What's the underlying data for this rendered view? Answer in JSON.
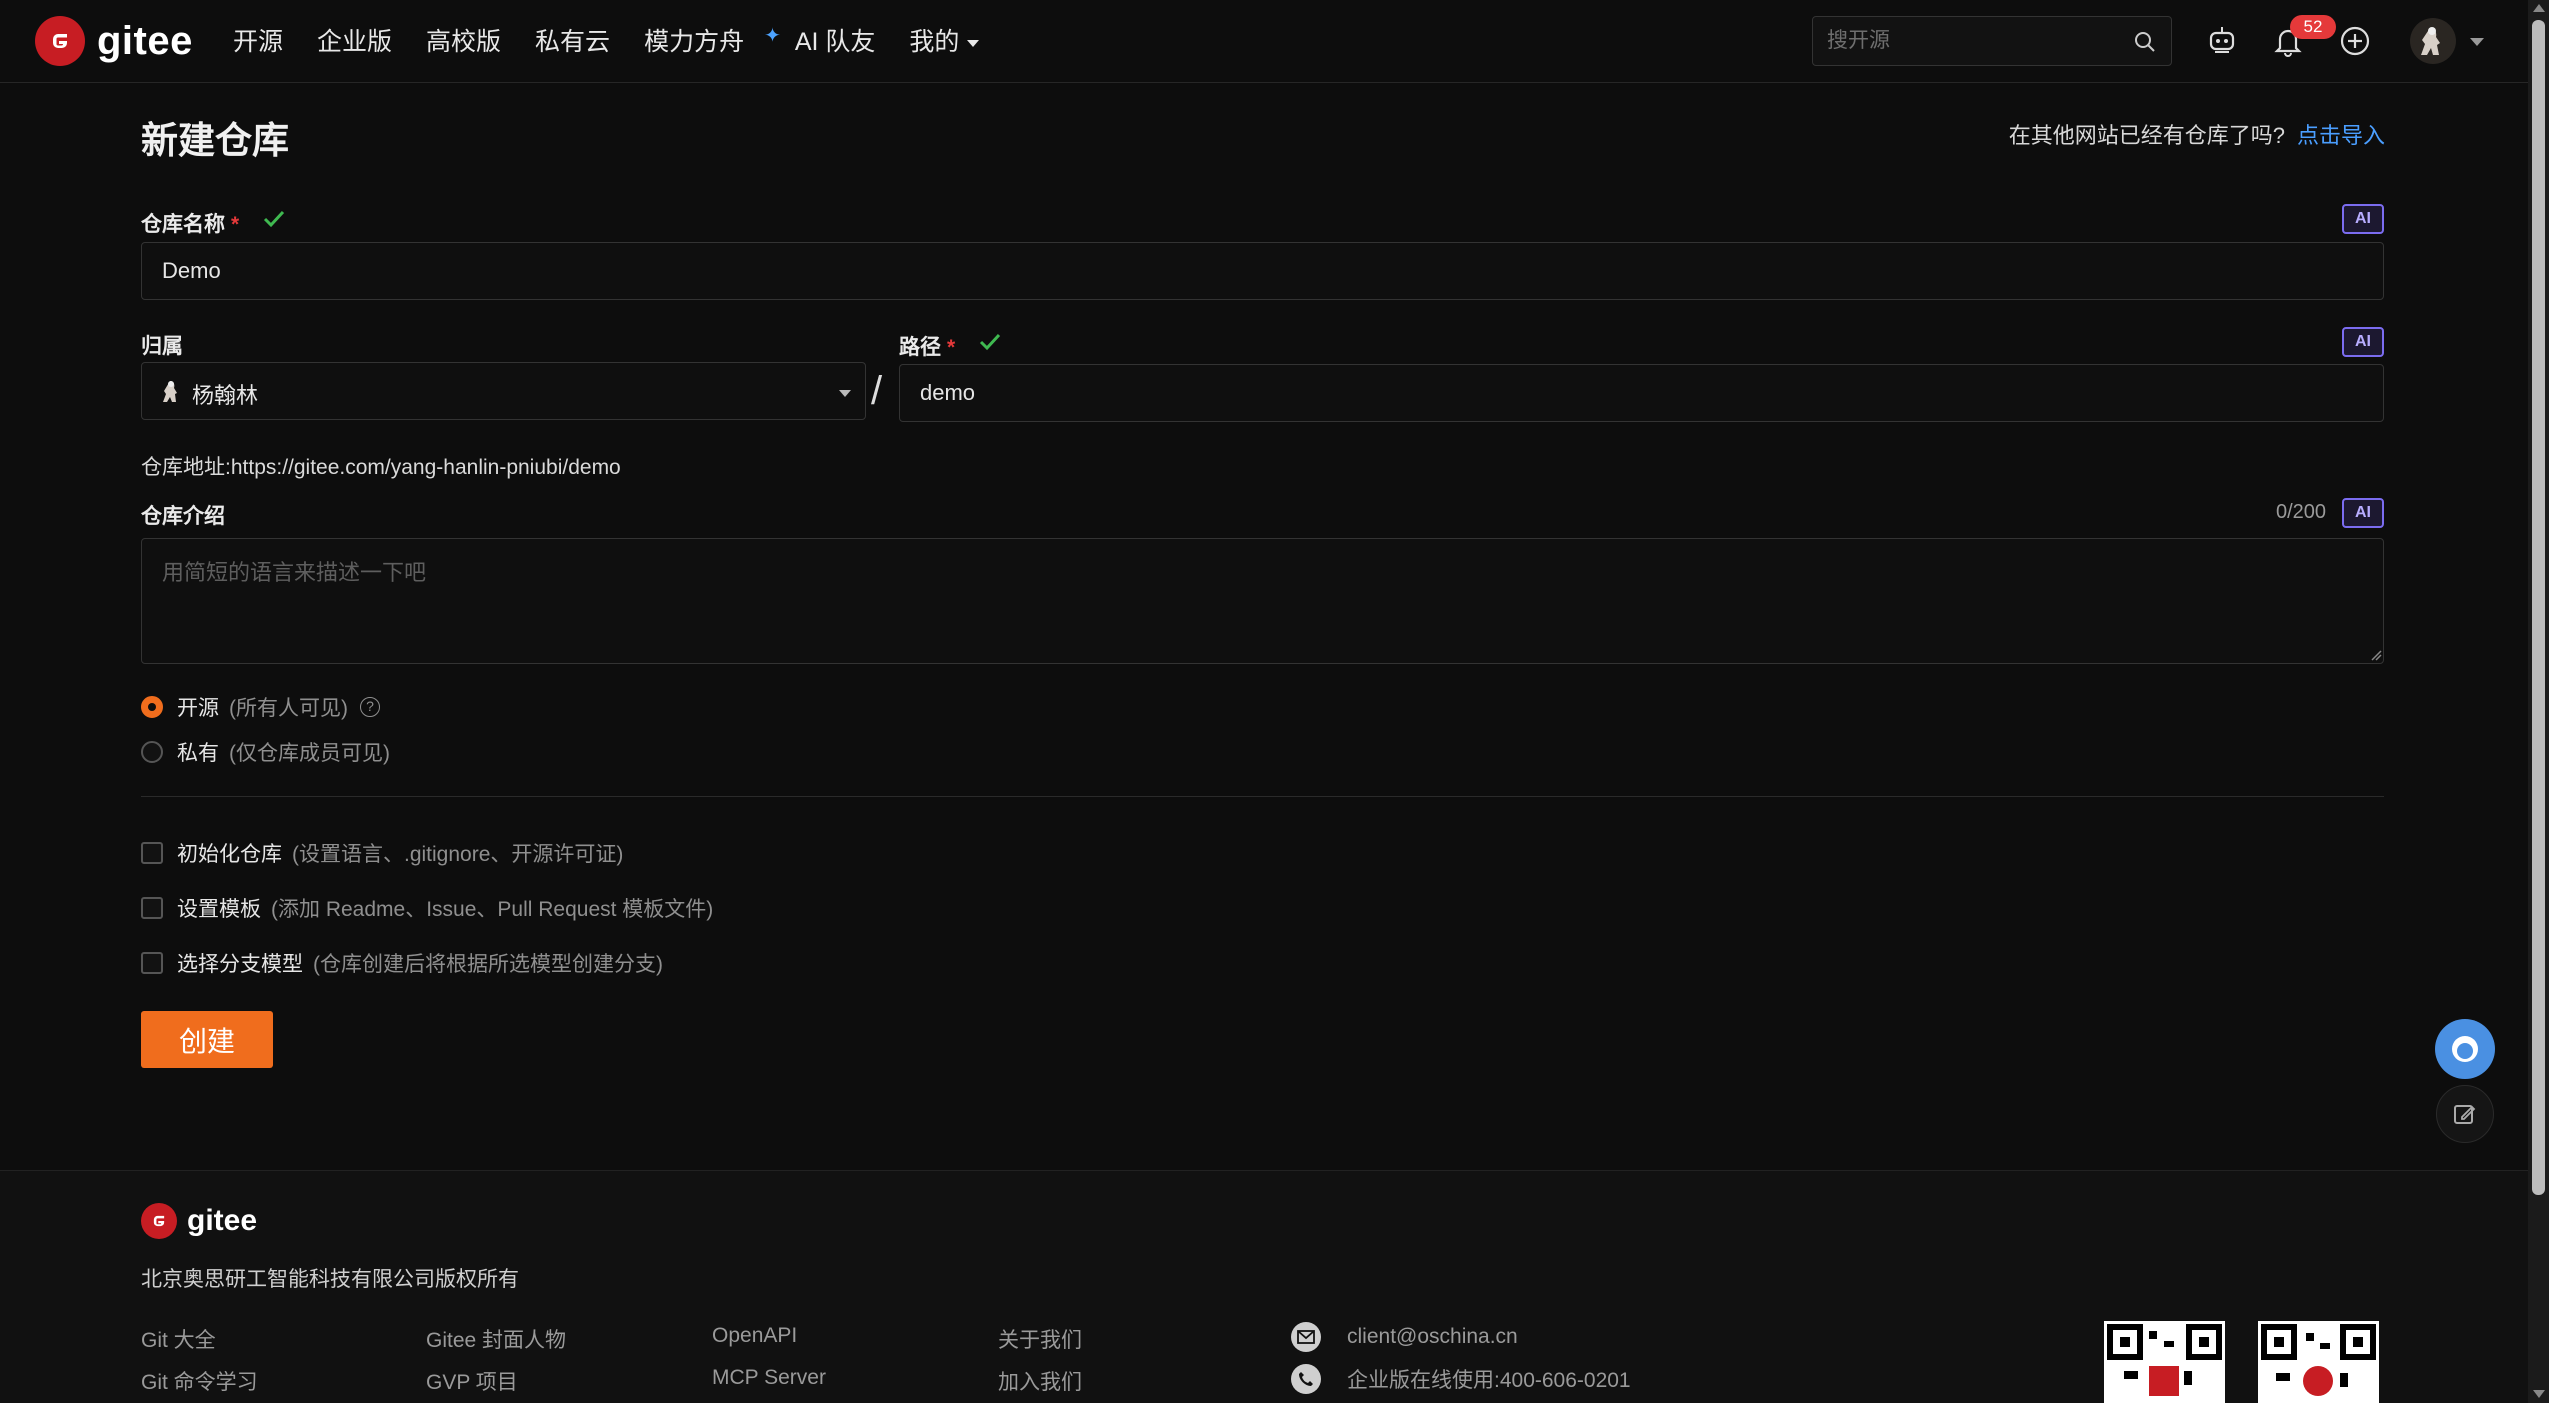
{
  "header": {
    "logo_text": "gitee",
    "nav": [
      "开源",
      "企业版",
      "高校版",
      "私有云",
      "模力方舟",
      "AI 队友",
      "我的"
    ],
    "search_placeholder": "搜开源",
    "notification_count": "52"
  },
  "page": {
    "title": "新建仓库",
    "import_prompt": "在其他网站已经有仓库了吗?",
    "import_link": "点击导入"
  },
  "form": {
    "name_label": "仓库名称",
    "required_mark": "*",
    "name_value": "Demo",
    "ai_label": "AI",
    "owner_label": "归属",
    "owner_value": "杨翰林",
    "path_label": "路径",
    "path_value": "demo",
    "slash": "/",
    "address_label": "仓库地址:",
    "address_value": "https://gitee.com/yang-hanlin-pniubi/demo",
    "desc_label": "仓库介绍",
    "desc_counter": "0/200",
    "desc_placeholder": "用简短的语言来描述一下吧",
    "visibility": [
      {
        "label": "开源",
        "hint": "(所有人可见)",
        "selected": true
      },
      {
        "label": "私有",
        "hint": "(仅仓库成员可见)",
        "selected": false
      }
    ],
    "options": [
      {
        "label": "初始化仓库",
        "hint": "(设置语言、.gitignore、开源许可证)",
        "checked": false
      },
      {
        "label": "设置模板",
        "hint": "(添加 Readme、Issue、Pull Request 模板文件)",
        "checked": false
      },
      {
        "label": "选择分支模型",
        "hint": "(仓库创建后将根据所选模型创建分支)",
        "checked": false
      }
    ],
    "submit_label": "创建"
  },
  "footer": {
    "logo_text": "gitee",
    "copyright": "北京奥思研工智能科技有限公司版权所有",
    "links": [
      [
        "Git 大全",
        "Git 命令学习"
      ],
      [
        "Gitee 封面人物",
        "GVP 项目"
      ],
      [
        "OpenAPI",
        "MCP Server"
      ],
      [
        "关于我们",
        "加入我们"
      ]
    ],
    "email": "client@oschina.cn",
    "phone": "企业版在线使用:400-606-0201"
  },
  "colors": {
    "accent": "#f06d1d",
    "link": "#4a9eff",
    "success": "#3fb950",
    "brand": "#c71d23"
  }
}
